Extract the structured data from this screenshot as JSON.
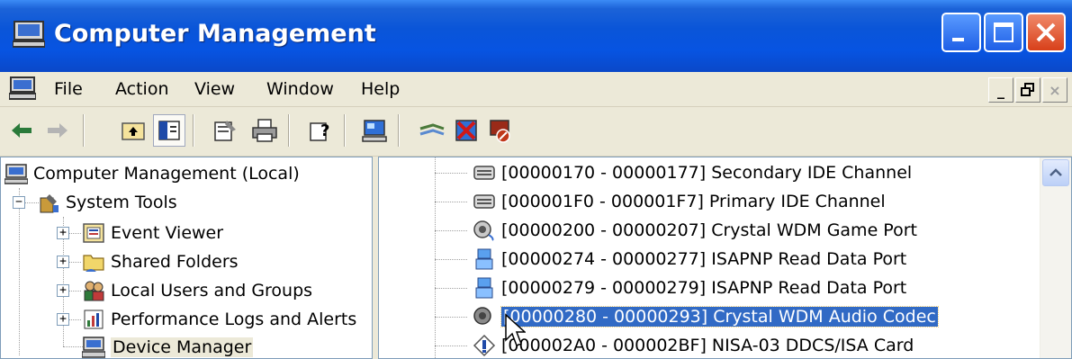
{
  "window": {
    "title": "Computer Management",
    "icon": "computer-management-icon",
    "controls": [
      "minimize-icon",
      "maximize-icon",
      "close-icon"
    ]
  },
  "menubar": {
    "items": [
      "File",
      "Action",
      "View",
      "Window",
      "Help"
    ]
  },
  "toolbar": {
    "buttons": [
      "back-arrow-icon",
      "forward-arrow-icon",
      "up-folder-icon",
      "show-hide-tree-icon",
      "properties-icon",
      "print-icon",
      "help-icon",
      "device-manager-icon",
      "network-icon",
      "uninstall-icon",
      "disable-device-icon"
    ]
  },
  "tree": {
    "root": "Computer Management (Local)",
    "system_tools": "System Tools",
    "children": [
      "Event Viewer",
      "Shared Folders",
      "Local Users and Groups",
      "Performance Logs and Alerts",
      "Device Manager"
    ]
  },
  "devices": {
    "rows": [
      {
        "label": "[00000170 - 00000177]  Secondary IDE Channel",
        "icon": "ide-channel-icon"
      },
      {
        "label": "[000001F0 - 000001F7]  Primary IDE Channel",
        "icon": "ide-channel-icon"
      },
      {
        "label": "[00000200 - 00000207]  Crystal WDM Game Port",
        "icon": "sound-device-icon"
      },
      {
        "label": "[00000274 - 00000277]  ISAPNP Read Data Port",
        "icon": "system-device-icon"
      },
      {
        "label": "[00000279 - 00000279]  ISAPNP Read Data Port",
        "icon": "system-device-icon"
      },
      {
        "label": "[00000280 - 00000293]  Crystal WDM Audio Codec",
        "icon": "sound-device-icon",
        "selected": true
      },
      {
        "label": "[000002A0 - 000002BF]  NISA-03 DDCS/ISA Card",
        "icon": "unknown-device-icon"
      }
    ]
  },
  "colors": {
    "titlebar": "#0a55d8",
    "selection": "#316ac5",
    "background": "#ece9d8"
  }
}
